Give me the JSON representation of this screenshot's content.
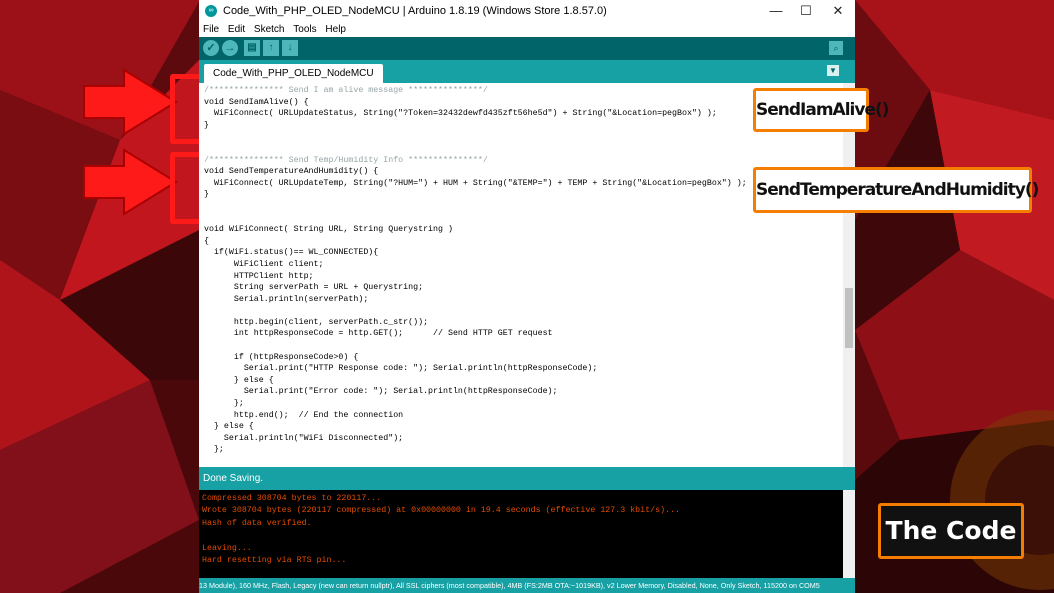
{
  "window": {
    "title": "Code_With_PHP_OLED_NodeMCU | Arduino 1.8.19 (Windows Store 1.8.57.0)",
    "controls": {
      "minimize": "—",
      "maximize": "☐",
      "close": "✕"
    }
  },
  "menu": [
    "File",
    "Edit",
    "Sketch",
    "Tools",
    "Help"
  ],
  "tab": {
    "label": "Code_With_PHP_OLED_NodeMCU"
  },
  "code_lines": [
    "/*************** Send I am alive message ***************/",
    "void SendIamAlive() {",
    "  WiFiConnect( URLUpdateStatus, String(\"?Token=32432dewfd435zft56he5d\") + String(\"&Location=pegBox\") );",
    "}",
    "",
    "",
    "/*************** Send Temp/Humidity Info ***************/",
    "void SendTemperatureAndHumidity() {",
    "  WiFiConnect( URLUpdateTemp, String(\"?HUM=\") + HUM + String(\"&TEMP=\") + TEMP + String(\"&Location=pegBox\") );",
    "}",
    "",
    "",
    "void WiFiConnect( String URL, String Querystring )",
    "{",
    "  if(WiFi.status()== WL_CONNECTED){",
    "      WiFiClient client;",
    "      HTTPClient http;",
    "      String serverPath = URL + Querystring;",
    "      Serial.println(serverPath);",
    "",
    "      http.begin(client, serverPath.c_str());",
    "      int httpResponseCode = http.GET();      // Send HTTP GET request",
    "",
    "      if (httpResponseCode>0) {",
    "        Serial.print(\"HTTP Response code: \"); Serial.println(httpResponseCode);",
    "      } else {",
    "        Serial.print(\"Error code: \"); Serial.println(httpResponseCode);",
    "      };",
    "      http.end();  // End the connection",
    "  } else {",
    "    Serial.println(\"WiFi Disconnected\");",
    "  };"
  ],
  "status_message": "Done Saving.",
  "console_lines": [
    "Compressed 308704 bytes to 220117...",
    "Wrote 308704 bytes (220117 compressed) at 0x00000000 in 19.4 seconds (effective 127.3 kbit/s)...",
    "Hash of data verified.",
    "",
    "Leaving...",
    "Hard resetting via RTS pin..."
  ],
  "board_info": "13 Module), 160 MHz, Flash, Legacy (new can return nullptr), All SSL ciphers (most compatible), 4MB (FS:2MB OTA:~1019KB), v2 Lower Memory, Disabled, None, Only Sketch, 115200 on COM5",
  "callouts": {
    "send_alive": "SendIamAlive()",
    "send_temp": "SendTemperatureAndHumidity()",
    "the_code": "The Code"
  },
  "colors": {
    "accent_orange": "#f57d00",
    "arrow_red": "#ff1a1a",
    "arduino_teal": "#00979c"
  }
}
